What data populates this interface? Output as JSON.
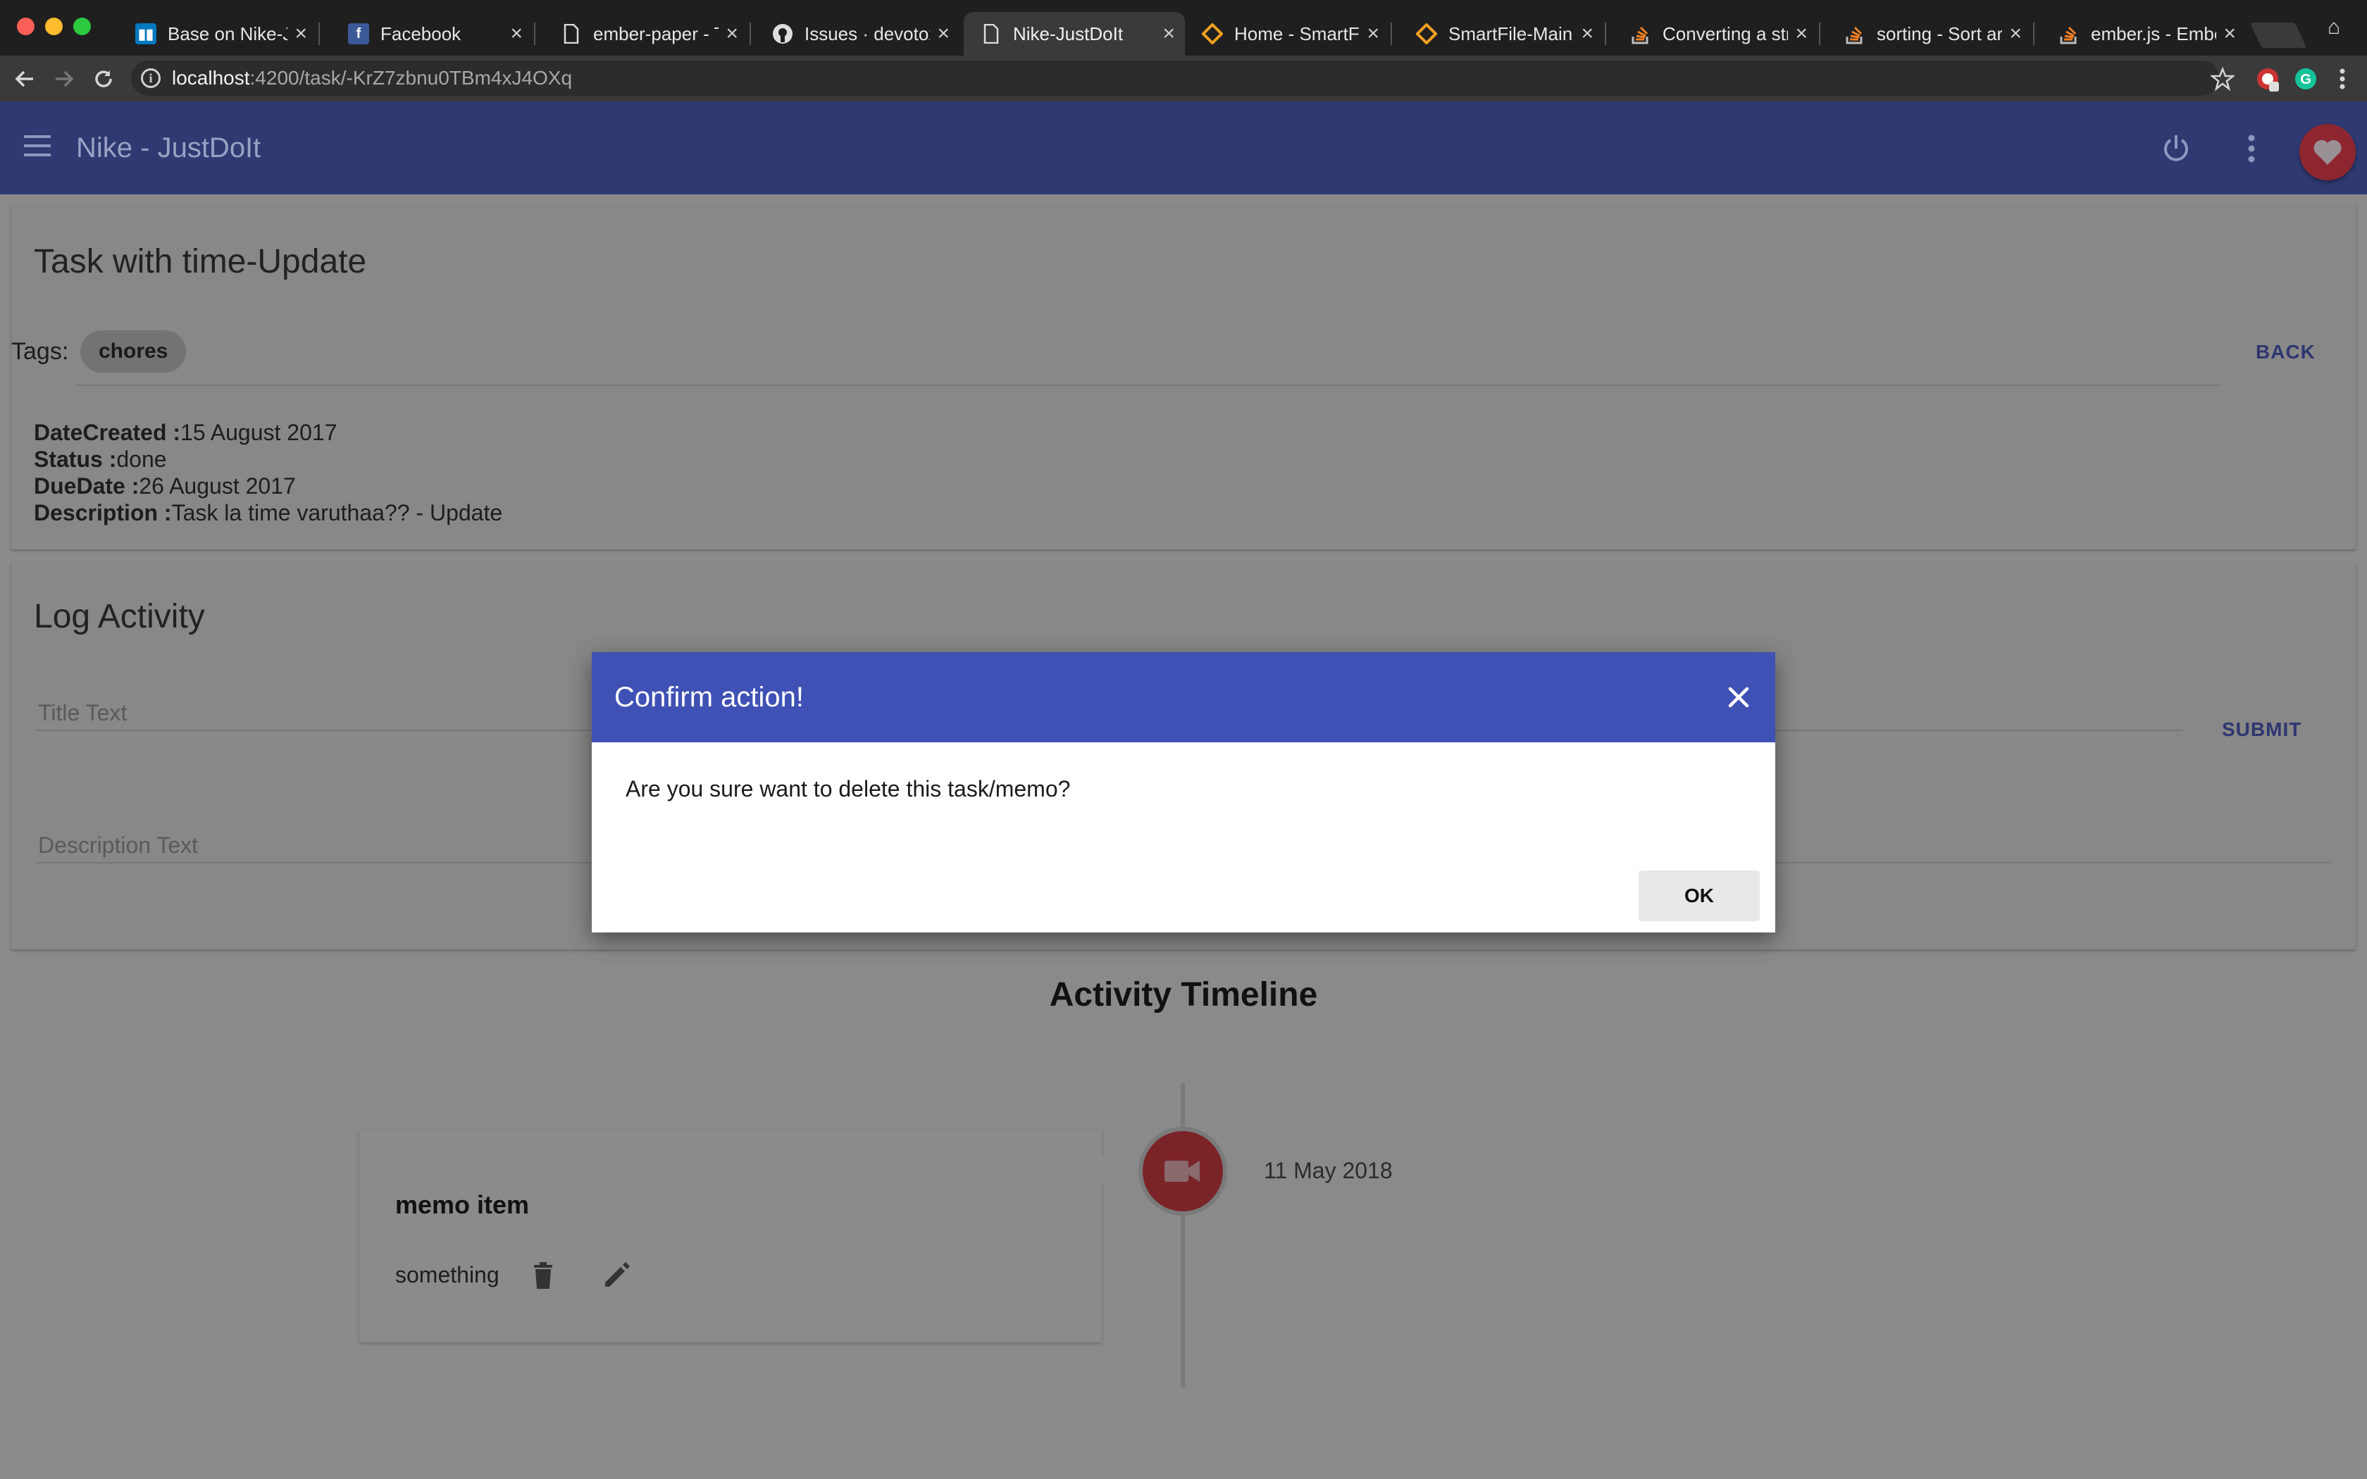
{
  "browser": {
    "tabs": [
      {
        "title": "Base on Nike-Jus",
        "icon": "trello-icon",
        "active": false
      },
      {
        "title": "Facebook",
        "icon": "facebook-icon",
        "active": false
      },
      {
        "title": "ember-paper - Th",
        "icon": "document-icon",
        "active": false
      },
      {
        "title": "Issues · devotox/",
        "icon": "github-icon",
        "active": false
      },
      {
        "title": "Nike-JustDoIt",
        "icon": "document-icon",
        "active": true
      },
      {
        "title": "Home - SmartFile",
        "icon": "smartfile-icon",
        "active": false
      },
      {
        "title": "SmartFile-Main V",
        "icon": "smartfile-icon",
        "active": false
      },
      {
        "title": "Converting a strin",
        "icon": "stackoverflow-icon",
        "active": false
      },
      {
        "title": "sorting - Sort arra",
        "icon": "stackoverflow-icon",
        "active": false
      },
      {
        "title": "ember.js - Ember",
        "icon": "stackoverflow-icon",
        "active": false
      }
    ],
    "url_host": "localhost",
    "url_path": ":4200/task/-KrZ7zbnu0TBm4xJ4OXq"
  },
  "app": {
    "title": "Nike - JustDoIt",
    "heart_color": "#8e2630"
  },
  "task": {
    "title": "Task with time-Update",
    "tags_label": "Tags:",
    "tags": [
      "chores"
    ],
    "back_label": "BACK",
    "details": [
      {
        "label": "DateCreated :",
        "value": "15 August 2017"
      },
      {
        "label": "Status :",
        "value": "done"
      },
      {
        "label": "DueDate :",
        "value": "26 August 2017"
      },
      {
        "label": "Description :",
        "value": "Task la time varuthaa?? - Update"
      }
    ]
  },
  "log": {
    "title": "Log Activity",
    "title_placeholder": "Title Text",
    "description_placeholder": "Description Text",
    "submit_label": "SUBMIT"
  },
  "timeline": {
    "heading": "Activity Timeline",
    "items": [
      {
        "date": "11 May 2018",
        "title": "memo item",
        "description": "something",
        "icon": "videocam-icon"
      }
    ]
  },
  "modal": {
    "title": "Confirm action!",
    "message": "Are you sure want to delete this task/memo?",
    "ok_label": "OK",
    "header_color": "#3f51b5"
  }
}
